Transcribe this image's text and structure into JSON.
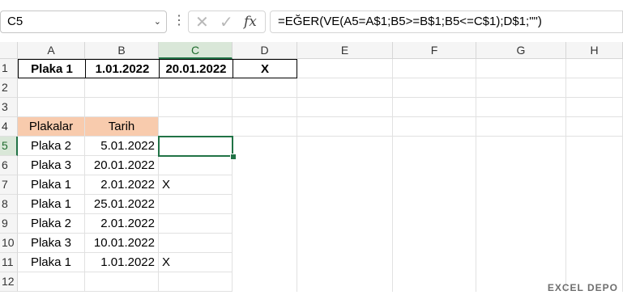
{
  "formula_bar": {
    "name_box": "C5",
    "formula": "=EĞER(VE(A5=A$1;B5>=B$1;B5<=C$1);D$1;\"\")"
  },
  "columns": [
    "A",
    "B",
    "C",
    "D",
    "E",
    "F",
    "G",
    "H"
  ],
  "rows": [
    "1",
    "2",
    "3",
    "4",
    "5",
    "6",
    "7",
    "8",
    "9",
    "10",
    "11",
    "12"
  ],
  "cells": {
    "A1": "Plaka 1",
    "B1": "1.01.2022",
    "C1": "20.01.2022",
    "D1": "X",
    "A4": "Plakalar",
    "B4": "Tarih",
    "A5": "Plaka 2",
    "B5": "5.01.2022",
    "A6": "Plaka 3",
    "B6": "20.01.2022",
    "A7": "Plaka 1",
    "B7": "2.01.2022",
    "C7": "X",
    "A8": "Plaka 1",
    "B8": "25.01.2022",
    "A9": "Plaka 2",
    "B9": "2.01.2022",
    "A10": "Plaka 3",
    "B10": "10.01.2022",
    "A11": "Plaka 1",
    "B11": "1.01.2022",
    "C11": "X"
  },
  "active_cell": "C5",
  "watermark": "EXCEL DEPO"
}
